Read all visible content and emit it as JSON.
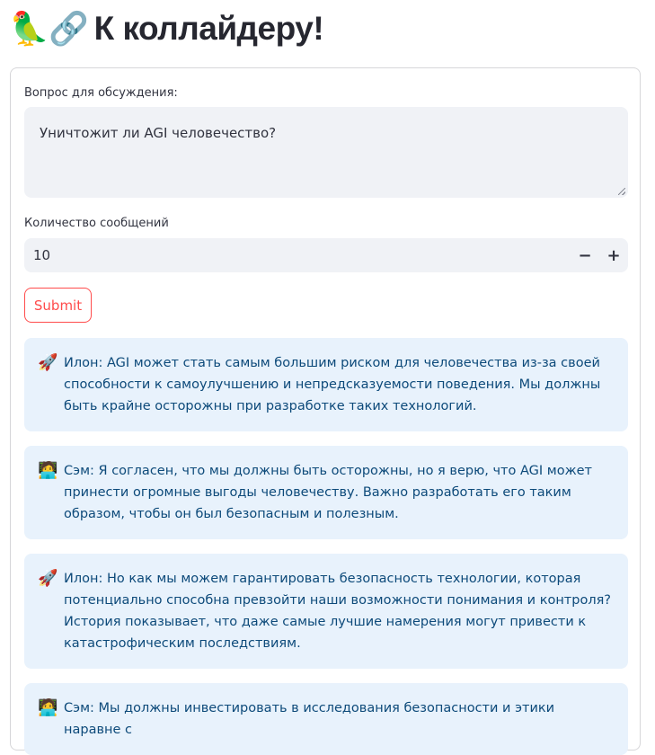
{
  "page": {
    "title_emoji": "🦜🔗",
    "title": "К коллайдеру!"
  },
  "form": {
    "question_label": "Вопрос для обсуждения:",
    "question_value": "Уничтожит ли AGI человечество?",
    "count_label": "Количество сообщений",
    "count_value": "10",
    "decrement_label": "−",
    "increment_label": "+",
    "submit_label": "Submit"
  },
  "messages": [
    {
      "avatar": "🚀",
      "text": "Илон: AGI может стать самым большим риском для человечества из-за своей способности к самоулучшению и непредсказуемости поведения. Мы должны быть крайне осторожны при разработке таких технологий."
    },
    {
      "avatar": "🧑‍💻",
      "text": "Сэм: Я согласен, что мы должны быть осторожны, но я верю, что AGI может принести огромные выгоды человечеству. Важно разработать его таким образом, чтобы он был безопасным и полезным."
    },
    {
      "avatar": "🚀",
      "text": "Илон: Но как мы можем гарантировать безопасность технологии, которая потенциально способна превзойти наши возможности понимания и контроля? История показывает, что даже самые лучшие намерения могут привести к катастрофическим последствиям."
    },
    {
      "avatar": "🧑‍💻",
      "text": "Сэм: Мы должны инвестировать в исследования безопасности и этики наравне с"
    }
  ]
}
